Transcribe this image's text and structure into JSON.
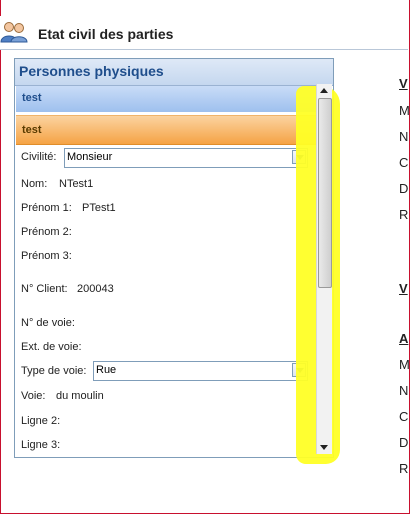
{
  "header": {
    "title": "Etat civil des parties",
    "icon": "users-icon"
  },
  "panel": {
    "title": "Personnes physiques",
    "rows": [
      "test",
      "test"
    ],
    "fields": {
      "civilite_label": "Civilité:",
      "civilite_value": "Monsieur",
      "nom_label": "Nom:",
      "nom_value": "NTest1",
      "prenom1_label": "Prénom 1:",
      "prenom1_value": "PTest1",
      "prenom2_label": "Prénom 2:",
      "prenom3_label": "Prénom 3:",
      "client_label": "N° Client:",
      "client_value": "200043",
      "num_voie_label": "N° de voie:",
      "ext_voie_label": "Ext. de voie:",
      "type_voie_label": "Type de voie:",
      "type_voie_value": "Rue",
      "voie_label": "Voie:",
      "voie_value": "du moulin",
      "ligne2_label": "Ligne 2:",
      "ligne3_label": "Ligne 3:"
    }
  },
  "right_column": [
    "V",
    "M",
    "N",
    "C",
    "D",
    "R",
    "V",
    "A",
    "M",
    "N",
    "C",
    "D",
    "R"
  ],
  "colors": {
    "highlight": "#ffff26",
    "accent": "#1f4e8c",
    "selected_row": "#f5a345",
    "border": "#c8102e"
  }
}
